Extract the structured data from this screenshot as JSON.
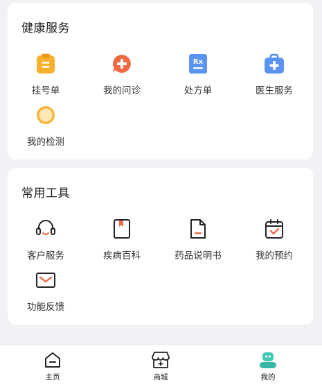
{
  "health": {
    "title": "健康服务",
    "items": [
      {
        "label": "挂号单",
        "icon": "clipboard-icon"
      },
      {
        "label": "我的问诊",
        "icon": "consult-plus-icon"
      },
      {
        "label": "处方单",
        "icon": "rx-icon"
      },
      {
        "label": "医生服务",
        "icon": "medical-bag-icon"
      },
      {
        "label": "我的检测",
        "icon": "detection-circle-icon"
      }
    ]
  },
  "tools": {
    "title": "常用工具",
    "items": [
      {
        "label": "客户服务",
        "icon": "headset-icon"
      },
      {
        "label": "疾病百科",
        "icon": "bookmark-book-icon"
      },
      {
        "label": "药品说明书",
        "icon": "document-icon"
      },
      {
        "label": "我的预约",
        "icon": "calendar-check-icon"
      },
      {
        "label": "功能反馈",
        "icon": "mail-icon"
      }
    ]
  },
  "tabbar": {
    "tabs": [
      {
        "label": "主页",
        "icon": "home-icon"
      },
      {
        "label": "商城",
        "icon": "store-icon"
      },
      {
        "label": "我的",
        "icon": "robot-avatar-icon",
        "active": true
      }
    ]
  },
  "colors": {
    "orange": "#f6a623",
    "coral": "#f06a44",
    "blue": "#4e8ff0",
    "accent_red": "#ef6a4a",
    "teal": "#3ec7b3"
  }
}
